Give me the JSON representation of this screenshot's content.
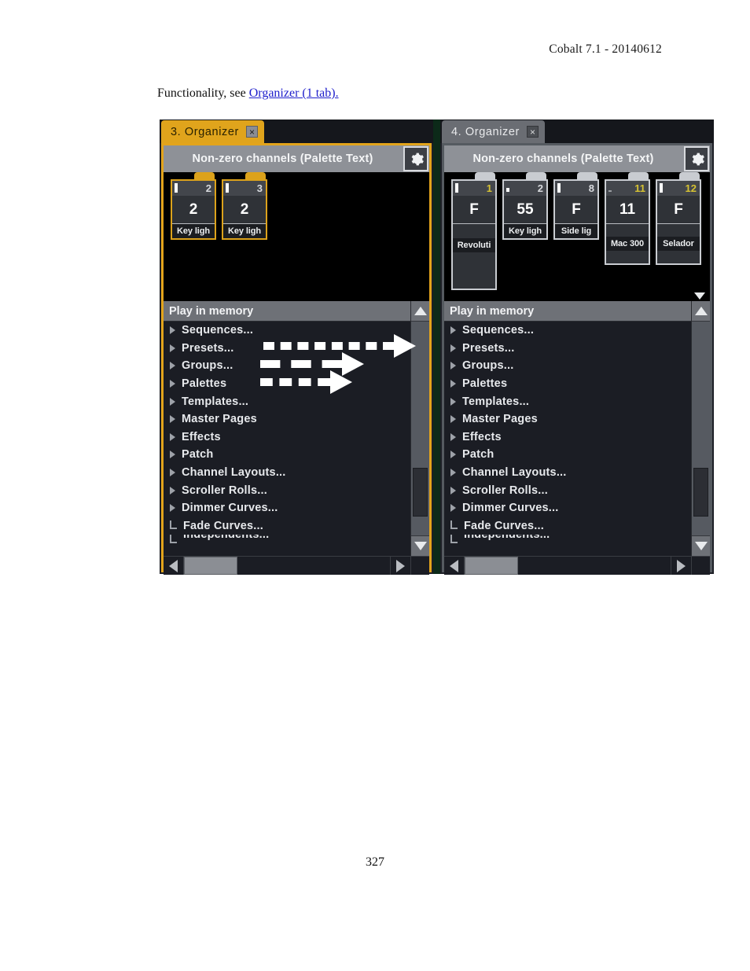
{
  "page": {
    "header": "Cobalt 7.1 - 20140612",
    "number": "327",
    "body_text_prefix": "Functionality, see ",
    "body_link": "Organizer (1 tab).",
    "link_color": "#2020cc"
  },
  "colors": {
    "active_tab": "#e0a41c",
    "inactive_tab": "#6a6d73",
    "backdrop_green": "#0c2a19",
    "tile_border_active": "#dca21b",
    "tile_border_inactive": "#c9ccd1",
    "channel_number_yellow": "#d6c233",
    "channel_number_white": "#d8dade",
    "panel_bg": "#1b1d24"
  },
  "panels": [
    {
      "id": "left",
      "state": "active",
      "tab": {
        "label": "3. Organizer",
        "close_icon": "×"
      },
      "titlebar": {
        "text": "Non-zero channels (Palette Text)",
        "gear_icon": "gear-icon"
      },
      "tiles": [
        {
          "number": "2",
          "number_color": "white",
          "value": "2",
          "label": "Key ligh",
          "marker": "bar",
          "height": "short"
        },
        {
          "number": "3",
          "number_color": "white",
          "value": "2",
          "label": "Key ligh",
          "marker": "bar",
          "height": "short"
        }
      ],
      "tray_scroll_down": false,
      "list": {
        "header": "Play in memory",
        "items": [
          {
            "label": "Sequences...",
            "type": "branch"
          },
          {
            "label": "Presets...",
            "type": "branch"
          },
          {
            "label": "Groups...",
            "type": "branch"
          },
          {
            "label": "Palettes",
            "type": "branch"
          },
          {
            "label": "Templates...",
            "type": "branch"
          },
          {
            "label": "Master Pages",
            "type": "branch"
          },
          {
            "label": "Effects",
            "type": "branch"
          },
          {
            "label": "Patch",
            "type": "branch"
          },
          {
            "label": "Channel Layouts...",
            "type": "branch"
          },
          {
            "label": "Scroller Rolls...",
            "type": "branch"
          },
          {
            "label": "Dimmer Curves...",
            "type": "branch"
          },
          {
            "label": "Fade Curves...",
            "type": "leaf"
          },
          {
            "label": "Independents...",
            "type": "leaf",
            "clipped": true
          }
        ]
      },
      "annotation_arrows": 3
    },
    {
      "id": "right",
      "state": "inactive",
      "tab": {
        "label": "4. Organizer",
        "close_icon": "×"
      },
      "titlebar": {
        "text": "Non-zero channels (Palette Text)",
        "gear_icon": "gear-icon"
      },
      "tiles": [
        {
          "number": "1",
          "number_color": "yellow",
          "value": "F",
          "label": "Revoluti",
          "marker": "bar",
          "height": "tall"
        },
        {
          "number": "2",
          "number_color": "white",
          "value": "55",
          "label": "Key ligh",
          "marker": "small",
          "height": "short"
        },
        {
          "number": "8",
          "number_color": "white",
          "value": "F",
          "label": "Side lig",
          "marker": "bar",
          "height": "short"
        },
        {
          "number": "11",
          "number_color": "yellow",
          "value": "11",
          "label": "Mac 300",
          "marker": "dash",
          "height": "medium"
        },
        {
          "number": "12",
          "number_color": "yellow",
          "value": "F",
          "label": "Selador",
          "marker": "bar",
          "height": "medium"
        }
      ],
      "tray_scroll_down": true,
      "list": {
        "header": "Play in memory",
        "items": [
          {
            "label": "Sequences...",
            "type": "branch"
          },
          {
            "label": "Presets...",
            "type": "branch"
          },
          {
            "label": "Groups...",
            "type": "branch"
          },
          {
            "label": "Palettes",
            "type": "branch"
          },
          {
            "label": "Templates...",
            "type": "branch"
          },
          {
            "label": "Master Pages",
            "type": "branch"
          },
          {
            "label": "Effects",
            "type": "branch"
          },
          {
            "label": "Patch",
            "type": "branch"
          },
          {
            "label": "Channel Layouts...",
            "type": "branch"
          },
          {
            "label": "Scroller Rolls...",
            "type": "branch"
          },
          {
            "label": "Dimmer Curves...",
            "type": "branch"
          },
          {
            "label": "Fade Curves...",
            "type": "leaf"
          },
          {
            "label": "Independents...",
            "type": "leaf",
            "clipped": true
          }
        ]
      },
      "annotation_arrows": 0
    }
  ]
}
